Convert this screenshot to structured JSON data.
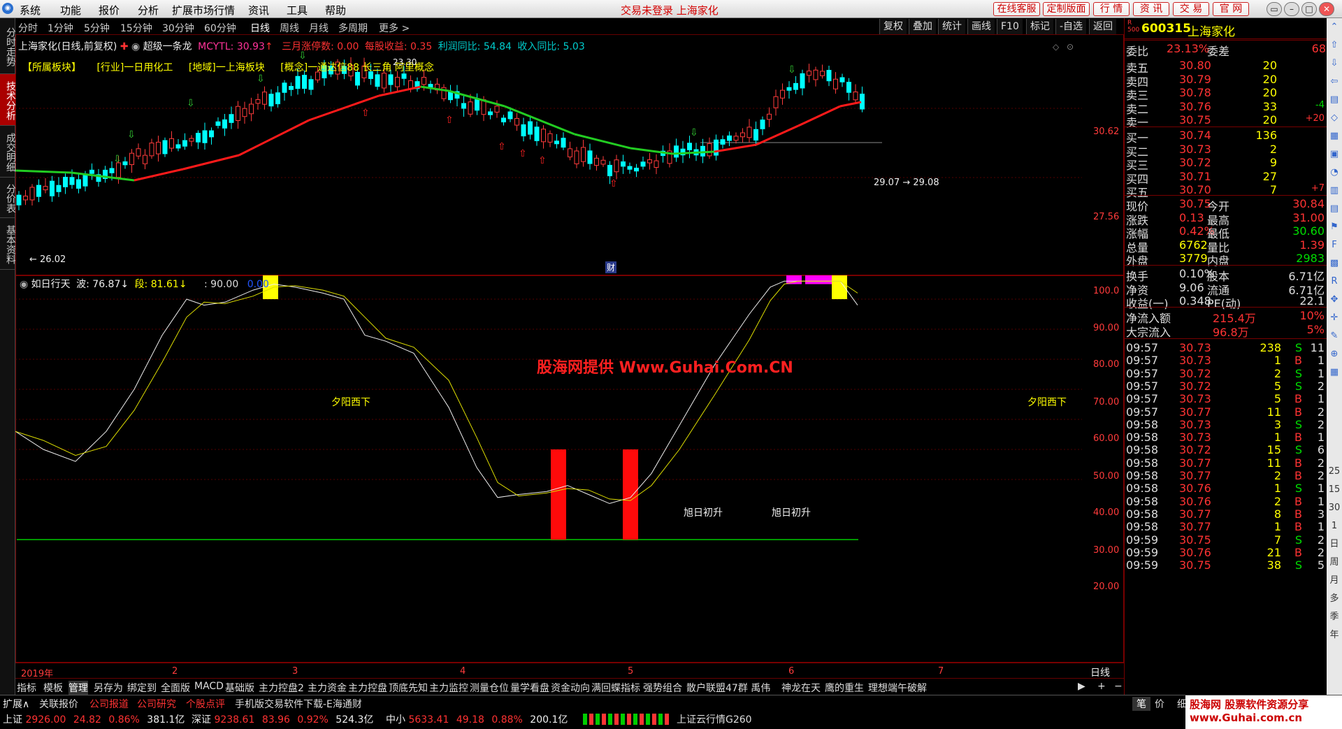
{
  "menubar": {
    "items": [
      "系统",
      "功能",
      "报价",
      "分析",
      "扩展市场行情",
      "资讯",
      "工具",
      "帮助"
    ],
    "center_notice": "交易未登录 上海家化",
    "right_buttons": [
      "在线客服",
      "定制版面",
      "行 情",
      "资 讯",
      "交 易",
      "官 网"
    ]
  },
  "left_nav": [
    "分时走势",
    "技术分析",
    "成交明细",
    "分价表",
    "基本资料"
  ],
  "period_tabs": [
    "分时",
    "1分钟",
    "5分钟",
    "15分钟",
    "30分钟",
    "60分钟",
    "日线",
    "周线",
    "月线",
    "多周期",
    "更多 >"
  ],
  "right_tools": [
    "复权",
    "叠加",
    "统计",
    "画线",
    "F10",
    "标记",
    "-自选",
    "返回"
  ],
  "info": {
    "title": "上海家化(日线,前复权)",
    "formula": "超级一条龙",
    "mcytl": "MCYTL: 30.93",
    "march_limit": "三月涨停数: 0.00",
    "eps": "每股收益: 0.35",
    "profit_yoy": "利润同比: 54.84",
    "income_yoy": "收入同比: 5.03"
  },
  "sectors": [
    "【所属板块】",
    "[行业]一日用化工",
    "[地域]一上海板块",
    "[概念]一通达信88 长三角 阿里概念"
  ],
  "price_axis": [
    "30.62",
    "27.56"
  ],
  "price_labels": {
    "low": "← 26.02",
    "high": "23.30",
    "mid": "29.07 → 29.08",
    "cai": "财"
  },
  "indicator": {
    "name": "如日行天",
    "bo": "波: 76.87",
    "duan": "段: 81.61",
    "level": ": 90.00",
    "zero": "0.00",
    "yaxis": [
      "100.0",
      "90.00",
      "80.00",
      "70.00",
      "60.00",
      "50.00",
      "40.00",
      "30.00",
      "20.00"
    ],
    "annotations": [
      "夕阳西下",
      "夕阳西下",
      "旭日初升",
      "旭日初升"
    ],
    "watermark": "股海网提供 Www.Guhai.Com.CN"
  },
  "time_axis": [
    "2019年",
    "2",
    "3",
    "4",
    "5",
    "6",
    "7"
  ],
  "period_label": "日线",
  "bottom_tabs": [
    "指标",
    "模板",
    "管理",
    "另存为",
    "绑定到",
    "全面版",
    "MACD",
    "基础版",
    "主力控盘2",
    "主力资金",
    "主力控盘",
    "顶底先知",
    "主力监控",
    "测量仓位",
    "量学看盘",
    "资金动向",
    "满回蝶指标",
    "强势组合",
    "散户联盟47群 禹伟",
    "神龙在天",
    "鹰的重生",
    "理想端午破解"
  ],
  "status": {
    "row1": [
      "扩展∧",
      "关联报价",
      "公司报道",
      "公司研究",
      "个股点评",
      "手机版交易软件下载-E海通财"
    ],
    "sh": [
      "上证",
      "2926.00",
      "24.82",
      "0.86%",
      "381.1亿"
    ],
    "sz": [
      "深证",
      "9238.61",
      "83.96",
      "0.92%",
      "524.3亿"
    ],
    "zx": [
      "中小",
      "5633.41",
      "49.18",
      "0.88%",
      "200.1亿"
    ],
    "cloud": "上证云行情G260",
    "bottom_right": [
      "笔",
      "价",
      "细",
      "资"
    ],
    "ad_text": "股海网 股票软件资源分享 www.Guhai.com.cn"
  },
  "quote": {
    "code": "600315",
    "name": "上海家化",
    "weibi_label": "委比",
    "weibi": "23.13%",
    "weicha_label": "委差",
    "weicha": "68",
    "asks": [
      {
        "label": "卖五",
        "price": "30.80",
        "vol": "20",
        "chg": ""
      },
      {
        "label": "卖四",
        "price": "30.79",
        "vol": "20",
        "chg": ""
      },
      {
        "label": "卖三",
        "price": "30.78",
        "vol": "20",
        "chg": ""
      },
      {
        "label": "卖二",
        "price": "30.76",
        "vol": "33",
        "chg": "-4"
      },
      {
        "label": "卖一",
        "price": "30.75",
        "vol": "20",
        "chg": "+20"
      }
    ],
    "bids": [
      {
        "label": "买一",
        "price": "30.74",
        "vol": "136",
        "chg": ""
      },
      {
        "label": "买二",
        "price": "30.73",
        "vol": "2",
        "chg": ""
      },
      {
        "label": "买三",
        "price": "30.72",
        "vol": "9",
        "chg": ""
      },
      {
        "label": "买四",
        "price": "30.71",
        "vol": "27",
        "chg": ""
      },
      {
        "label": "买五",
        "price": "30.70",
        "vol": "7",
        "chg": "+7"
      }
    ],
    "stats": [
      [
        "现价",
        "30.75",
        "今开",
        "30.84"
      ],
      [
        "涨跌",
        "0.13",
        "最高",
        "31.00"
      ],
      [
        "涨幅",
        "0.42%",
        "最低",
        "30.60"
      ],
      [
        "总量",
        "6762",
        "量比",
        "1.39"
      ],
      [
        "外盘",
        "3779",
        "内盘",
        "2983"
      ]
    ],
    "stats2": [
      [
        "换手",
        "0.10%",
        "股本",
        "6.71亿"
      ],
      [
        "净资",
        "9.06",
        "流通",
        "6.71亿"
      ],
      [
        "收益(一)",
        "0.348",
        "PE(动)",
        "22.1"
      ]
    ],
    "flows": [
      [
        "净流入额",
        "215.4万",
        "10%"
      ],
      [
        "大宗流入",
        "96.8万",
        "5%"
      ]
    ],
    "ticks": [
      [
        "09:57",
        "30.73",
        "238",
        "S",
        "11"
      ],
      [
        "09:57",
        "30.73",
        "1",
        "B",
        "1"
      ],
      [
        "09:57",
        "30.72",
        "2",
        "S",
        "1"
      ],
      [
        "09:57",
        "30.72",
        "5",
        "S",
        "2"
      ],
      [
        "09:57",
        "30.73",
        "5",
        "B",
        "1"
      ],
      [
        "09:57",
        "30.77",
        "11",
        "B",
        "2"
      ],
      [
        "09:58",
        "30.73",
        "3",
        "S",
        "2"
      ],
      [
        "09:58",
        "30.73",
        "1",
        "B",
        "1"
      ],
      [
        "09:58",
        "30.72",
        "15",
        "S",
        "6"
      ],
      [
        "09:58",
        "30.77",
        "11",
        "B",
        "2"
      ],
      [
        "09:58",
        "30.77",
        "2",
        "B",
        "2"
      ],
      [
        "09:58",
        "30.76",
        "1",
        "S",
        "1"
      ],
      [
        "09:58",
        "30.76",
        "2",
        "B",
        "1"
      ],
      [
        "09:58",
        "30.77",
        "8",
        "B",
        "3"
      ],
      [
        "09:58",
        "30.77",
        "1",
        "B",
        "1"
      ],
      [
        "09:59",
        "30.75",
        "7",
        "S",
        "2"
      ],
      [
        "09:59",
        "30.76",
        "21",
        "B",
        "2"
      ],
      [
        "09:59",
        "30.75",
        "38",
        "S",
        "5"
      ]
    ]
  }
}
